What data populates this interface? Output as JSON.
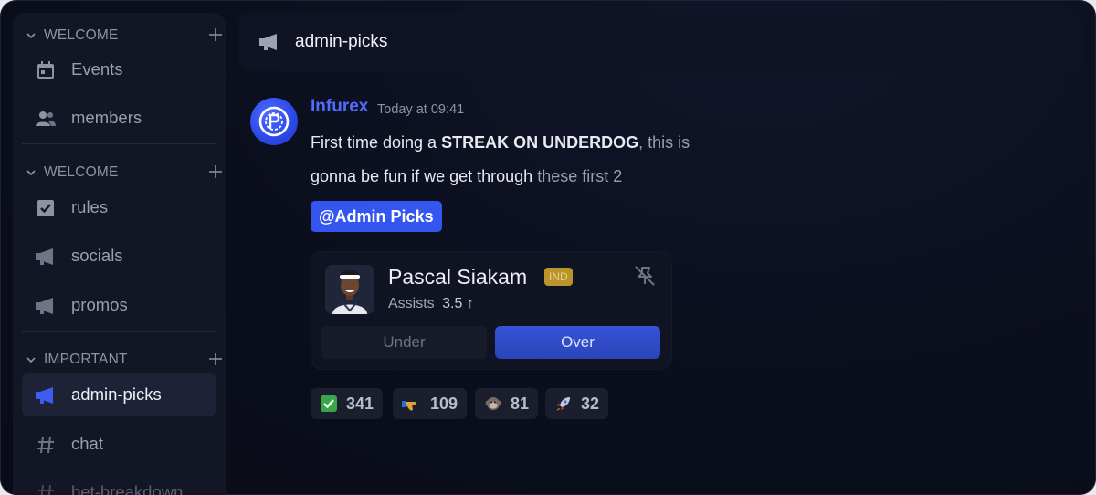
{
  "sidebar": {
    "sections": [
      {
        "title": "WELCOME",
        "items": [
          {
            "label": "Events",
            "icon": "calendar-icon"
          },
          {
            "label": "members",
            "icon": "people-icon"
          }
        ]
      },
      {
        "title": "WELCOME",
        "items": [
          {
            "label": "rules",
            "icon": "checklist-icon"
          },
          {
            "label": "socials",
            "icon": "megaphone-icon"
          },
          {
            "label": "promos",
            "icon": "megaphone-icon"
          }
        ]
      },
      {
        "title": "IMPORTANT",
        "items": [
          {
            "label": "admin-picks",
            "icon": "megaphone-icon",
            "active": true
          },
          {
            "label": "chat",
            "icon": "hash-icon"
          },
          {
            "label": "bet-breakdown",
            "icon": "hash-icon"
          }
        ]
      }
    ]
  },
  "header": {
    "channel": "admin-picks",
    "icon": "megaphone-icon"
  },
  "message": {
    "author": "Infurex",
    "time": "Today at 09:41",
    "line1_a": "First time doing a ",
    "line1_b": "STREAK ON UNDERDOG",
    "line1_c": ", this is",
    "line2_a": "gonna be fun if we get through ",
    "line2_b": "these first 2",
    "mention": "@Admin Picks"
  },
  "pick_card": {
    "player": "Pascal Siakam",
    "team": "IND",
    "stat_label": "Assists",
    "stat_value": "3.5",
    "arrow": "↑",
    "under_label": "Under",
    "over_label": "Over",
    "selected": "Over"
  },
  "reactions": [
    {
      "emoji": "check-emoji",
      "count": "341"
    },
    {
      "emoji": "pointing-hand-emoji",
      "count": "109"
    },
    {
      "emoji": "monkey-emoji",
      "count": "81"
    },
    {
      "emoji": "rocket-emoji",
      "count": "32"
    }
  ],
  "colors": {
    "accent": "#3556ee",
    "author": "#4e6dff",
    "badge": "#b8942a",
    "background": "#0b0e1c",
    "sidebar": "#121625"
  }
}
